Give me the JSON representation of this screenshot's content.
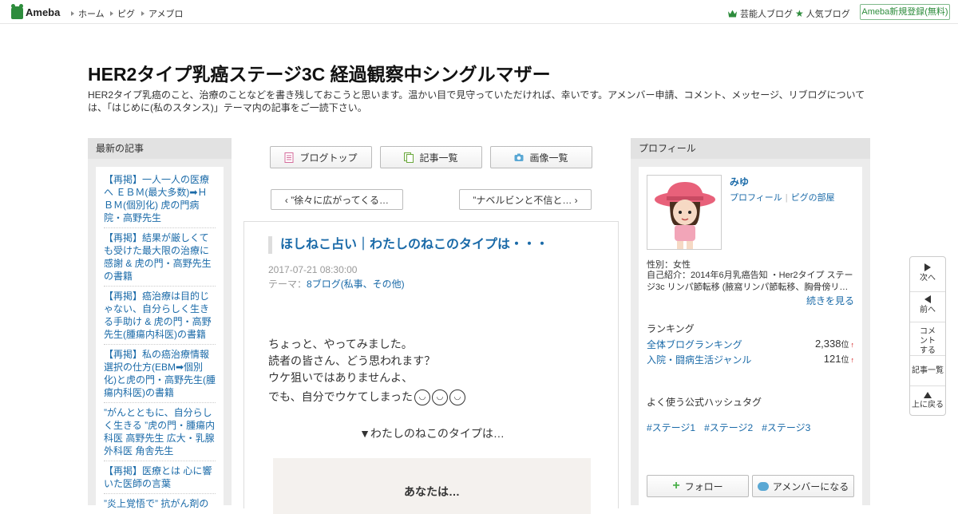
{
  "topbar": {
    "logo_text": "Ameba",
    "nav": [
      "ホーム",
      "ピグ",
      "アメブロ"
    ],
    "right_links": [
      "芸能人ブログ",
      "人気ブログ"
    ],
    "signup": "Ameba新規登録(無料)"
  },
  "header": {
    "title": "HER2タイプ乳癌ステージ3C 経過観察中シングルマザー",
    "description": "HER2タイプ乳癌のこと、治療のことなどを書き残しておこうと思います。温かい目で見守っていただければ、幸いです。アメンバー申請、コメント、メッセージ、リブログについては、「はじめに(私のスタンス)」テーマ内の記事をご一読下さい。"
  },
  "left_sidebar": {
    "heading": "最新の記事",
    "items": [
      "【再掲】一人一人の医療へ ＥＢＭ(最大多数)➡ＨＢＭ(個別化) 虎の門病院・高野先生",
      "【再掲】結果が厳しくても受けた最大限の治療に感謝 & 虎の門・高野先生の書籍",
      "【再掲】癌治療は目的じゃない、自分らしく生きる手助け & 虎の門・高野先生(腫瘍内科医)の書籍",
      "【再掲】私の癌治療情報選択の仕方(EBM➡個別化)と虎の門・高野先生(腫瘍内科医)の書籍",
      "”がんとともに、自分らしく生きる ”虎の門・腫瘍内科医 高野先生 広大・乳腺外科医 角舎先生",
      "【再掲】医療とは 心に響いた医師の言葉",
      "”炎上覚悟で” 抗がん剤の"
    ]
  },
  "center": {
    "tabs": [
      "ブログトップ",
      "記事一覧",
      "画像一覧"
    ],
    "prev": "‹ ”徐々に広がってくる…",
    "next": "”ナベルビンと不信と… ›",
    "article": {
      "title": "ほしねこ占い｜わたしのねこのタイプは・・・",
      "date": "2017-07-21 08:30:00",
      "theme_label": "テーマ：",
      "theme": "8ブログ(私事、その他)",
      "lines": [
        "ちょっと、やってみました。",
        "読者の皆さん、どう思われます？",
        "ウケ狙いではありませんよ、",
        "でも、自分でウケてしまった"
      ],
      "center_text": "▼わたしのねこのタイプは…",
      "image_text": "あなたは…"
    }
  },
  "right_sidebar": {
    "heading": "プロフィール",
    "name": "みゆ",
    "links": [
      "プロフィール",
      "ピグの部屋"
    ],
    "sex": "性別：女性",
    "intro": "自己紹介：2014年6月乳癌告知 ・Her2タイプ ステージ3c リンパ節転移 (腋窩リンパ節転移、胸骨傍リ…",
    "more": "続きを見る",
    "ranking_heading": "ランキング",
    "rankings": [
      {
        "label": "全体ブログランキング",
        "value": "2,338",
        "unit": "位"
      },
      {
        "label": "入院・闘病生活ジャンル",
        "value": "121",
        "unit": "位"
      }
    ],
    "hashtag_heading": "よく使う公式ハッシュタグ",
    "hashtags": [
      "#ステージ1",
      "#ステージ2",
      "#ステージ3"
    ],
    "follow": "フォロー",
    "amember": "アメンバーになる"
  },
  "sidenav": {
    "next": "次へ",
    "prev": "前へ",
    "comment": "コメントする",
    "list": "記事一覧",
    "top": "上に戻る"
  },
  "colors": {
    "link": "#1a6aa8",
    "brand": "#2d8c3c"
  }
}
